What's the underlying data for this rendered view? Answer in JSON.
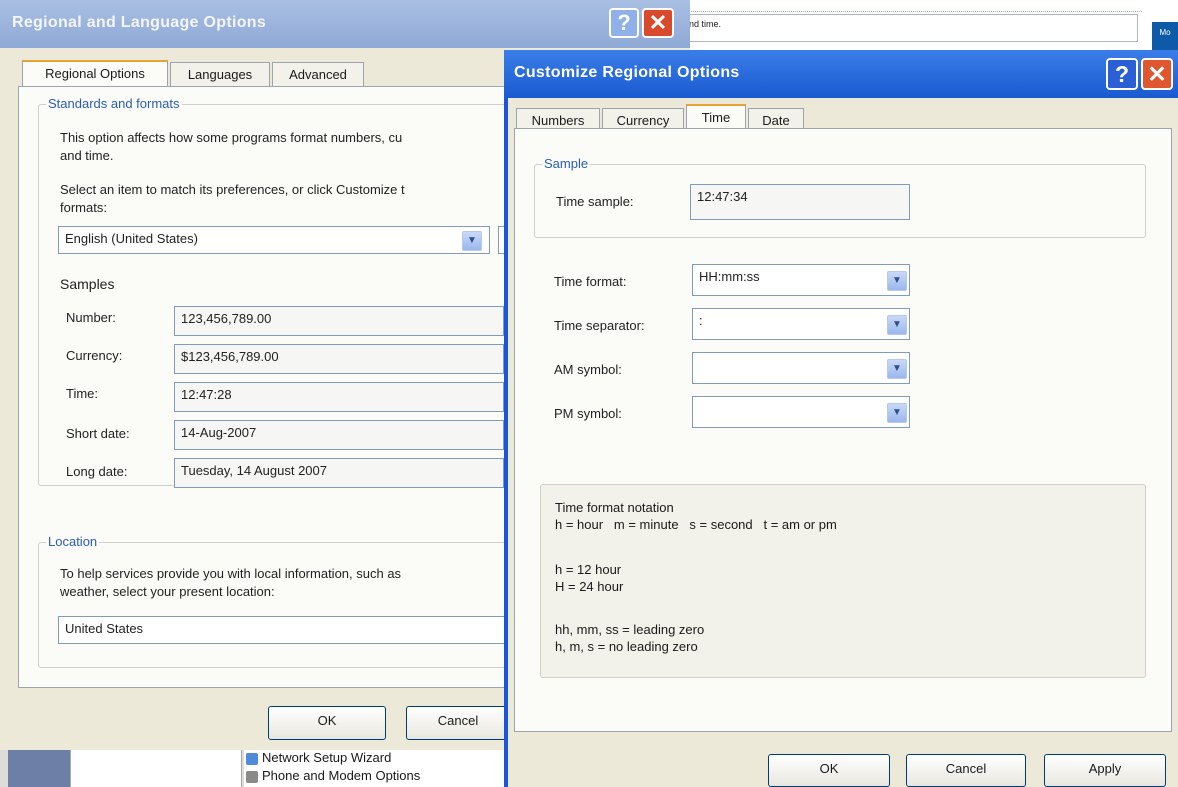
{
  "background_app": {
    "textbox_text": "nd time.",
    "edge_button_text": "Mo"
  },
  "regional_window": {
    "title": "Regional and Language Options",
    "help_glyph": "?",
    "close_glyph": "✕",
    "tabs": [
      {
        "label": "Regional Options",
        "active": true
      },
      {
        "label": "Languages",
        "active": false
      },
      {
        "label": "Advanced",
        "active": false
      }
    ],
    "standards_group_label": "Standards and formats",
    "standards_desc_line1": "This option affects how some programs format numbers, cu",
    "standards_desc_line2": "and time.",
    "select_desc_line1": "Select an item to match its preferences, or click Customize t",
    "select_desc_line2": "formats:",
    "locale_value": "English (United States)",
    "samples_label": "Samples",
    "samples": [
      {
        "label": "Number:",
        "value": "123,456,789.00"
      },
      {
        "label": "Currency:",
        "value": "$123,456,789.00"
      },
      {
        "label": "Time:",
        "value": "12:47:28"
      },
      {
        "label": "Short date:",
        "value": "14-Aug-2007"
      },
      {
        "label": "Long date:",
        "value": "Tuesday, 14 August 2007"
      }
    ],
    "location_group_label": "Location",
    "location_desc_line1": "To help services provide you with local information, such as",
    "location_desc_line2": "weather, select your present location:",
    "location_value": "United States",
    "ok_label": "OK",
    "cancel_label": "Cancel"
  },
  "control_panel": {
    "items": [
      "Network Setup Wizard",
      "Phone and Modem Options"
    ]
  },
  "customize_window": {
    "title": "Customize Regional Options",
    "help_glyph": "?",
    "close_glyph": "✕",
    "tabs": [
      {
        "label": "Numbers",
        "active": false
      },
      {
        "label": "Currency",
        "active": false
      },
      {
        "label": "Time",
        "active": true
      },
      {
        "label": "Date",
        "active": false
      }
    ],
    "sample_group_label": "Sample",
    "time_sample_label": "Time sample:",
    "time_sample_value": "12:47:34",
    "time_format_label": "Time format:",
    "time_format_value": "HH:mm:ss",
    "time_separator_label": "Time separator:",
    "time_separator_value": ":",
    "am_symbol_label": "AM symbol:",
    "am_symbol_value": "",
    "pm_symbol_label": "PM symbol:",
    "pm_symbol_value": "",
    "notation": {
      "heading": "Time format notation",
      "legend_line": "h = hour   m = minute   s = second   t = am or pm",
      "h12": "h = 12 hour",
      "h24": "H = 24 hour",
      "leading_zero": "hh, mm, ss = leading zero",
      "no_leading_zero": "h, m, s = no leading zero"
    },
    "ok_label": "OK",
    "cancel_label": "Cancel",
    "apply_label": "Apply"
  }
}
